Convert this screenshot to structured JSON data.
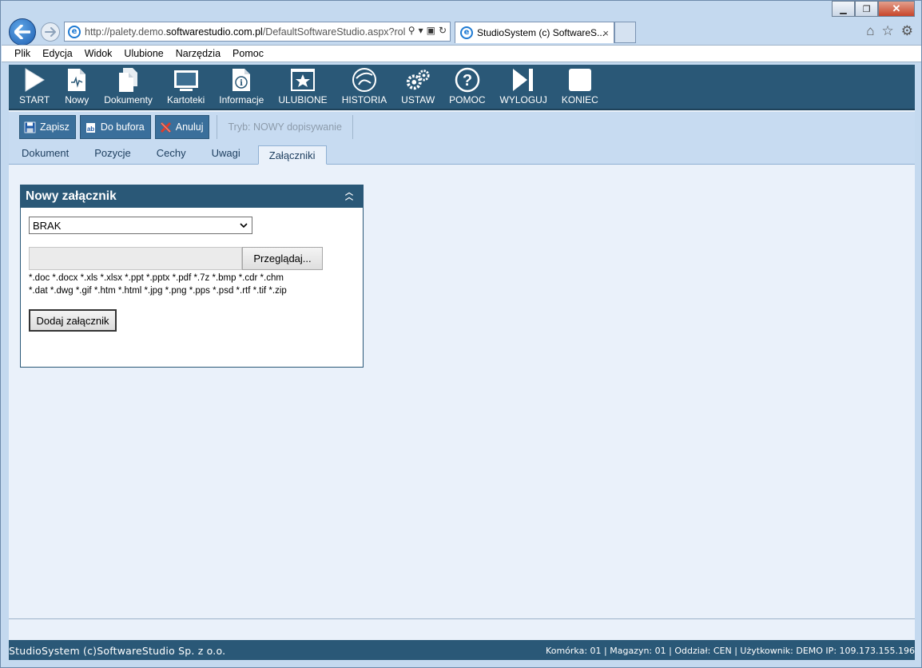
{
  "browser": {
    "address_prefix": "http://palety.demo.",
    "address_domain": "softwarestudio.com.pl",
    "address_suffix": "/DefaultSoftwareStudio.aspx?rol",
    "tab_title": "StudioSystem (c) SoftwareS...",
    "tab_close": "×"
  },
  "menu": [
    {
      "label": "Plik"
    },
    {
      "label": "Edycja"
    },
    {
      "label": "Widok"
    },
    {
      "label": "Ulubione"
    },
    {
      "label": "Narzędzia"
    },
    {
      "label": "Pomoc"
    }
  ],
  "toolbar": [
    {
      "label": "START",
      "icon": "play-icon"
    },
    {
      "label": "Nowy",
      "icon": "new-document-icon"
    },
    {
      "label": "Dokumenty",
      "icon": "documents-icon"
    },
    {
      "label": "Kartoteki",
      "icon": "monitor-icon"
    },
    {
      "label": "Informacje",
      "icon": "info-icon"
    },
    {
      "label": "ULUBIONE",
      "icon": "star-icon"
    },
    {
      "label": "HISTORIA",
      "icon": "history-icon"
    },
    {
      "label": "USTAW",
      "icon": "gears-icon"
    },
    {
      "label": "POMOC",
      "icon": "help-icon"
    },
    {
      "label": "WYLOGUJ",
      "icon": "logout-icon"
    },
    {
      "label": "KONIEC",
      "icon": "stop-icon"
    }
  ],
  "actions": {
    "save": "Zapisz",
    "to_buffer": "Do bufora",
    "cancel": "Anuluj",
    "mode": "Tryb: NOWY dopisywanie"
  },
  "tabs": [
    {
      "label": "Dokument"
    },
    {
      "label": "Pozycje"
    },
    {
      "label": "Cechy"
    },
    {
      "label": "Uwagi"
    },
    {
      "label": "Załączniki",
      "active": true
    }
  ],
  "panel": {
    "title": "Nowy załącznik",
    "attachment_type": "BRAK",
    "browse_label": "Przeglądaj...",
    "extensions_line1": "*.doc *.docx *.xls *.xlsx *.ppt *.pptx *.pdf *.7z *.bmp *.cdr *.chm",
    "extensions_line2": "*.dat *.dwg *.gif *.htm *.html *.jpg *.png *.pps *.psd *.rtf *.tif *.zip",
    "add_label": "Dodaj załącznik"
  },
  "status": {
    "left": "StudioSystem (c)SoftwareStudio Sp. z o.o.",
    "right": "Komórka: 01 | Magazyn: 01 | Oddział: CEN | Użytkownik: DEMO IP: 109.173.155.196"
  },
  "colors": {
    "toolbar_bg": "#2a5877",
    "action_btn_bg": "#3a6f9b",
    "content_bg": "#eaf1fa"
  }
}
